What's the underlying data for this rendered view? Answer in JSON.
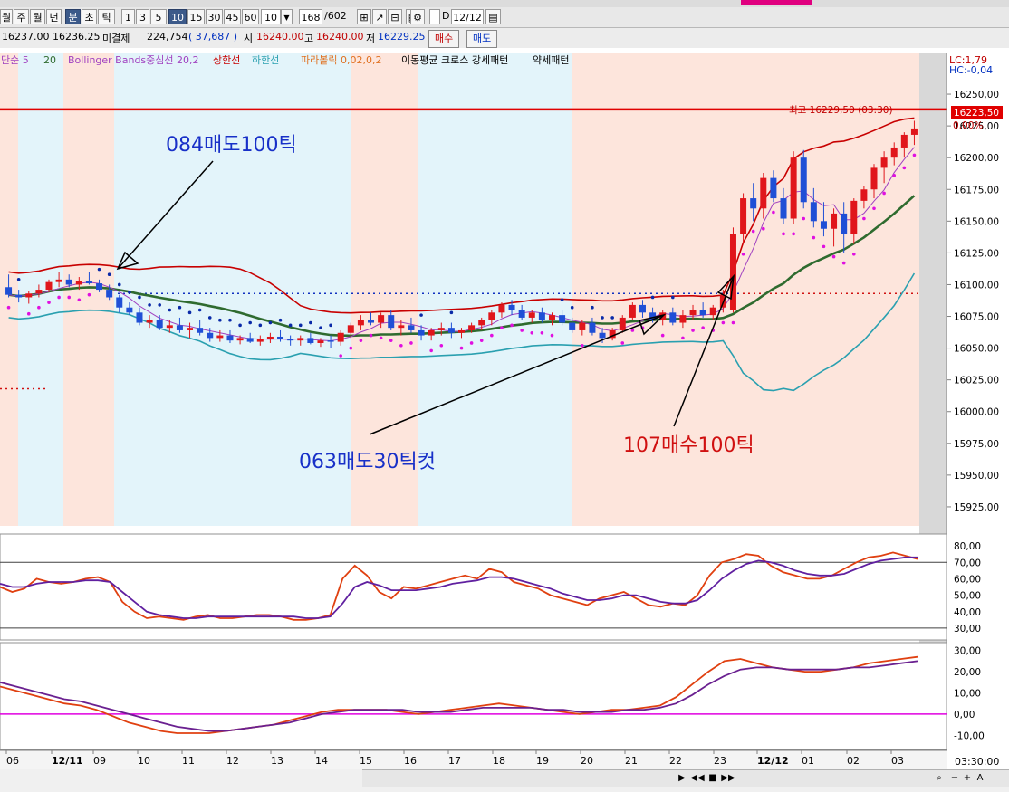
{
  "toolbar": {
    "periods": [
      "월",
      "주",
      "월",
      "년",
      "분",
      "초",
      "틱"
    ],
    "selected_period": "분",
    "intervals": [
      "1",
      "3",
      "5",
      "10",
      "15",
      "30",
      "45",
      "60"
    ],
    "selected_interval": "10",
    "interval_select": "10",
    "count": "168",
    "count_total": "/602",
    "date_label": "D",
    "date_value": "12/12"
  },
  "quote": {
    "price1": "16237.00",
    "price2": "16236.25",
    "oi_label": "미결제",
    "oi_value": "224,754",
    "oi_change": "( 37,687 )",
    "open_label": "시",
    "open_value": "16240.00",
    "high_label": "고",
    "high_value": "16240.00",
    "low_label": "저",
    "low_value": "16229.25",
    "buy_label": "매수",
    "sell_label": "매도"
  },
  "legend": {
    "ma": "단순 5",
    "ma_period": "20",
    "bb": "Bollinger Bands중심선 20,2",
    "upper": "상한선",
    "lower": "하한선",
    "sar": "파라볼릭 0,02,0,2",
    "pattern": "이동평균 크로스 강세패턴",
    "weak": "약세패턴"
  },
  "colors": {
    "up": "#e0161b",
    "down": "#1f4fd6",
    "bb_upper": "#c80000",
    "bb_lower": "#2aa0b0",
    "ma_long": "#2f6b2f",
    "ma_short": "#a040c0",
    "sar_down": "#0a2aa8",
    "sar_up": "#e010e0",
    "shade_pink": "#fde5dc",
    "shade_blue": "#e3f4fa",
    "hline": "#e00000"
  },
  "chart_data": [
    {
      "type": "candlestick",
      "title": "",
      "ylim": [
        15905,
        16265
      ],
      "yticks": [
        "16250,00",
        "16225,00",
        "16200,00",
        "16175,00",
        "16150,00",
        "16125,00",
        "16100,00",
        "16075,00",
        "16050,00",
        "16025,00",
        "16000,00",
        "15975,00",
        "15950,00",
        "15925,00"
      ],
      "xticks": [
        "06",
        "12/11",
        "09",
        "10",
        "11",
        "12",
        "13",
        "14",
        "15",
        "16",
        "17",
        "18",
        "19",
        "20",
        "21",
        "22",
        "23",
        "12/12",
        "01",
        "02",
        "03"
      ],
      "lc_label": "LC:1,79",
      "hc_label": "HC:-0,04",
      "last_price": "16223,50",
      "last_change": "0,00%",
      "high_annotation": "최고 16229,50 (03:30)",
      "red_line": 16238,
      "dotted_ref": 16093,
      "candles": [
        [
          16098,
          16108,
          16090,
          16092
        ],
        [
          16092,
          16096,
          16086,
          16090
        ],
        [
          16090,
          16095,
          16085,
          16093
        ],
        [
          16093,
          16100,
          16090,
          16096
        ],
        [
          16096,
          16104,
          16094,
          16102
        ],
        [
          16102,
          16110,
          16098,
          16104
        ],
        [
          16104,
          16108,
          16098,
          16100
        ],
        [
          16100,
          16106,
          16096,
          16103
        ],
        [
          16103,
          16110,
          16100,
          16101
        ],
        [
          16101,
          16104,
          16094,
          16096
        ],
        [
          16096,
          16100,
          16088,
          16090
        ],
        [
          16090,
          16092,
          16078,
          16082
        ],
        [
          16082,
          16086,
          16076,
          16078
        ],
        [
          16078,
          16082,
          16068,
          16070
        ],
        [
          16070,
          16076,
          16066,
          16072
        ],
        [
          16072,
          16076,
          16064,
          16066
        ],
        [
          16066,
          16072,
          16062,
          16068
        ],
        [
          16068,
          16074,
          16062,
          16064
        ],
        [
          16064,
          16070,
          16058,
          16066
        ],
        [
          16066,
          16072,
          16060,
          16062
        ],
        [
          16062,
          16066,
          16055,
          16058
        ],
        [
          16058,
          16064,
          16055,
          16060
        ],
        [
          16060,
          16064,
          16054,
          16056
        ],
        [
          16056,
          16060,
          16053,
          16058
        ],
        [
          16058,
          16062,
          16054,
          16055
        ],
        [
          16055,
          16060,
          16052,
          16057
        ],
        [
          16057,
          16062,
          16054,
          16059
        ],
        [
          16059,
          16064,
          16055,
          16057
        ],
        [
          16057,
          16060,
          16052,
          16056
        ],
        [
          16056,
          16060,
          16052,
          16058
        ],
        [
          16058,
          16062,
          16053,
          16054
        ],
        [
          16054,
          16058,
          16051,
          16056
        ],
        [
          16056,
          16060,
          16050,
          16055
        ],
        [
          16055,
          16064,
          16052,
          16062
        ],
        [
          16062,
          16070,
          16058,
          16068
        ],
        [
          16068,
          16076,
          16064,
          16072
        ],
        [
          16072,
          16078,
          16068,
          16070
        ],
        [
          16070,
          16078,
          16066,
          16076
        ],
        [
          16076,
          16080,
          16064,
          16066
        ],
        [
          16066,
          16072,
          16060,
          16068
        ],
        [
          16068,
          16074,
          16062,
          16064
        ],
        [
          16064,
          16068,
          16056,
          16060
        ],
        [
          16060,
          16066,
          16056,
          16064
        ],
        [
          16064,
          16070,
          16060,
          16066
        ],
        [
          16066,
          16070,
          16058,
          16062
        ],
        [
          16062,
          16066,
          16058,
          16064
        ],
        [
          16064,
          16070,
          16062,
          16068
        ],
        [
          16068,
          16074,
          16064,
          16072
        ],
        [
          16072,
          16080,
          16068,
          16078
        ],
        [
          16078,
          16086,
          16074,
          16084
        ],
        [
          16084,
          16088,
          16076,
          16080
        ],
        [
          16080,
          16084,
          16072,
          16074
        ],
        [
          16074,
          16080,
          16070,
          16078
        ],
        [
          16078,
          16082,
          16070,
          16072
        ],
        [
          16072,
          16078,
          16068,
          16076
        ],
        [
          16076,
          16080,
          16068,
          16070
        ],
        [
          16070,
          16074,
          16062,
          16064
        ],
        [
          16064,
          16072,
          16060,
          16070
        ],
        [
          16070,
          16074,
          16060,
          16062
        ],
        [
          16062,
          16066,
          16054,
          16058
        ],
        [
          16058,
          16066,
          16056,
          16064
        ],
        [
          16064,
          16076,
          16062,
          16074
        ],
        [
          16074,
          16086,
          16072,
          16084
        ],
        [
          16084,
          16088,
          16074,
          16078
        ],
        [
          16078,
          16082,
          16070,
          16072
        ],
        [
          16072,
          16080,
          16068,
          16078
        ],
        [
          16078,
          16082,
          16068,
          16070
        ],
        [
          16070,
          16080,
          16066,
          16076
        ],
        [
          16076,
          16084,
          16072,
          16080
        ],
        [
          16080,
          16086,
          16074,
          16076
        ],
        [
          16076,
          16084,
          16072,
          16082
        ],
        [
          16082,
          16096,
          16078,
          16092
        ],
        [
          16080,
          16145,
          16078,
          16140
        ],
        [
          16140,
          16172,
          16132,
          16168
        ],
        [
          16168,
          16180,
          16150,
          16160
        ],
        [
          16160,
          16188,
          16152,
          16184
        ],
        [
          16184,
          16190,
          16165,
          16168
        ],
        [
          16168,
          16176,
          16148,
          16152
        ],
        [
          16152,
          16205,
          16148,
          16200
        ],
        [
          16200,
          16206,
          16160,
          16165
        ],
        [
          16165,
          16176,
          16145,
          16150
        ],
        [
          16150,
          16165,
          16138,
          16144
        ],
        [
          16144,
          16160,
          16130,
          16156
        ],
        [
          16156,
          16165,
          16125,
          16140
        ],
        [
          16140,
          16168,
          16132,
          16166
        ],
        [
          16166,
          16178,
          16160,
          16175
        ],
        [
          16175,
          16195,
          16168,
          16192
        ],
        [
          16192,
          16205,
          16180,
          16200
        ],
        [
          16200,
          16212,
          16194,
          16208
        ],
        [
          16208,
          16220,
          16200,
          16218
        ],
        [
          16218,
          16229,
          16210,
          16223
        ]
      ]
    },
    {
      "type": "line",
      "name": "stochastic",
      "ylim": [
        25,
        85
      ],
      "yticks": [
        "80,00",
        "70,00",
        "60,00",
        "50,00",
        "40,00",
        "30,00"
      ],
      "series": [
        {
          "color": "#e04010",
          "values": [
            55,
            52,
            54,
            60,
            58,
            57,
            58,
            60,
            61,
            58,
            46,
            40,
            36,
            37,
            36,
            35,
            37,
            38,
            36,
            36,
            37,
            38,
            38,
            37,
            35,
            35,
            36,
            38,
            60,
            68,
            62,
            52,
            48,
            55,
            54,
            56,
            58,
            60,
            62,
            60,
            66,
            64,
            58,
            56,
            54,
            50,
            48,
            46,
            44,
            48,
            50,
            52,
            48,
            44,
            43,
            45,
            44,
            50,
            62,
            70,
            72,
            75,
            74,
            68,
            64,
            62,
            60,
            60,
            62,
            66,
            70,
            73,
            74,
            76,
            74,
            72
          ]
        },
        {
          "color": "#6020a0",
          "values": [
            57,
            55,
            55,
            57,
            58,
            58,
            58,
            59,
            59,
            58,
            52,
            46,
            40,
            38,
            37,
            36,
            36,
            37,
            37,
            37,
            37,
            37,
            37,
            37,
            37,
            36,
            36,
            37,
            45,
            55,
            58,
            56,
            53,
            53,
            53,
            54,
            55,
            57,
            58,
            59,
            61,
            61,
            60,
            58,
            56,
            54,
            51,
            49,
            47,
            47,
            48,
            50,
            50,
            48,
            46,
            45,
            45,
            47,
            53,
            60,
            65,
            69,
            71,
            70,
            68,
            65,
            63,
            62,
            62,
            63,
            66,
            69,
            71,
            72,
            73,
            73
          ]
        }
      ]
    },
    {
      "type": "line",
      "name": "macd",
      "ylim": [
        -15,
        32
      ],
      "yticks": [
        "30,00",
        "20,00",
        "10,00",
        "0,00",
        "-10,00"
      ],
      "series": [
        {
          "color": "#e04010",
          "values": [
            13,
            11,
            9,
            7,
            5,
            4,
            2,
            -1,
            -4,
            -6,
            -8,
            -9,
            -9,
            -9,
            -8,
            -7,
            -6,
            -5,
            -3,
            -1,
            1,
            2,
            2,
            2,
            2,
            1,
            0,
            1,
            2,
            3,
            4,
            5,
            4,
            3,
            2,
            1,
            0,
            1,
            2,
            2,
            3,
            4,
            8,
            14,
            20,
            25,
            26,
            24,
            22,
            21,
            20,
            20,
            21,
            22,
            24,
            25,
            26,
            27
          ]
        },
        {
          "color": "#6a2090",
          "values": [
            15,
            13,
            11,
            9,
            7,
            6,
            4,
            2,
            0,
            -2,
            -4,
            -6,
            -7,
            -8,
            -8,
            -7,
            -6,
            -5,
            -4,
            -2,
            0,
            1,
            2,
            2,
            2,
            2,
            1,
            1,
            1,
            2,
            3,
            3,
            3,
            3,
            2,
            2,
            1,
            1,
            1,
            2,
            2,
            3,
            5,
            9,
            14,
            18,
            21,
            22,
            22,
            21,
            21,
            21,
            21,
            22,
            22,
            23,
            24,
            25
          ]
        }
      ]
    }
  ],
  "annotations": {
    "a1": "084매도100틱",
    "a2": "063매도30틱컷",
    "a3": "107매수100틱"
  },
  "time_label": "03:30:00",
  "scroll": {
    "play": "▶",
    "prev": "◀◀",
    "stop": "■",
    "next": "▶▶"
  }
}
